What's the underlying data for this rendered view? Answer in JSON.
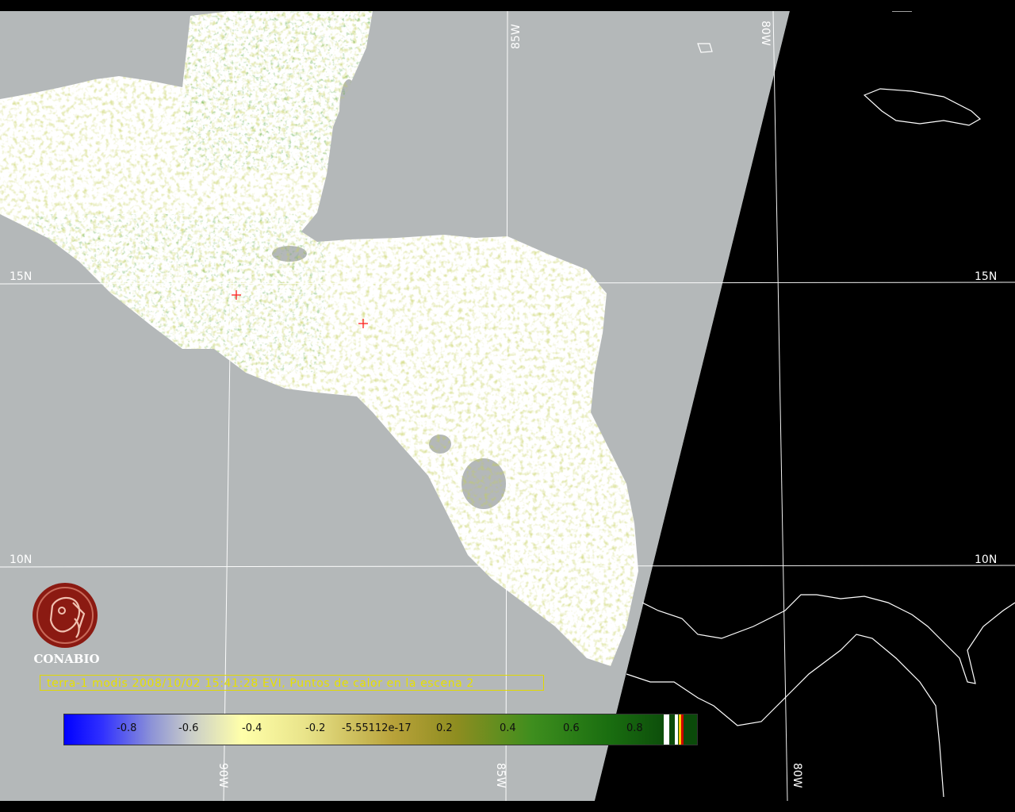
{
  "grid_labels": {
    "lon_85w_top": "85W",
    "lon_80w_top": "80W",
    "lat_15n_left": "15N",
    "lat_15n_right": "15N",
    "lat_10n_left": "10N",
    "lat_10n_right": "10N",
    "lon_90w_bottom": "90W",
    "lon_85w_bottom": "85W",
    "lon_80w_bottom": "80W"
  },
  "caption": "terra-1 modis 2008/10/02 15:41:28 EVI, Puntos de calor en la escena 2",
  "logo": {
    "name": "CONABIO",
    "color": "#8b1a12"
  },
  "colorbar": {
    "labels": [
      "-0.8",
      "-0.6",
      "-0.4",
      "-0.2",
      "-5.55112e-17",
      "0.2",
      "0.4",
      "0.6",
      "0.8"
    ],
    "end_stripes": [
      "#ffffff",
      "#ffffff",
      "#ffcc00",
      "#cc0000"
    ]
  },
  "colors": {
    "swath_gray": "#b4b8b9",
    "land_white": "#ffffff",
    "outside_black": "#000000",
    "caption_yellow": "#e6e000"
  },
  "hotspots_count": 2
}
